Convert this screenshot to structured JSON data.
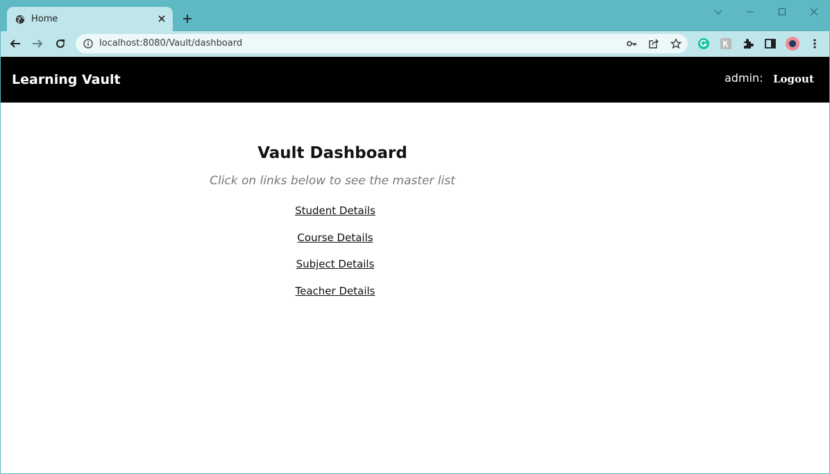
{
  "browser": {
    "tab": {
      "title": "Home"
    },
    "url": "localhost:8080/Vault/dashboard"
  },
  "navbar": {
    "brand": "Learning Vault",
    "user_label": "admin:",
    "logout_label": "Logout"
  },
  "dashboard": {
    "title": "Vault Dashboard",
    "subtitle": "Click on links below to see the master list",
    "links": [
      {
        "label": "Student Details"
      },
      {
        "label": "Course Details"
      },
      {
        "label": "Subject Details"
      },
      {
        "label": "Teacher Details"
      }
    ]
  },
  "colors": {
    "tabstrip": "#5fb9c4",
    "toolbar": "#bfe6ea",
    "navbar": "#000000"
  }
}
